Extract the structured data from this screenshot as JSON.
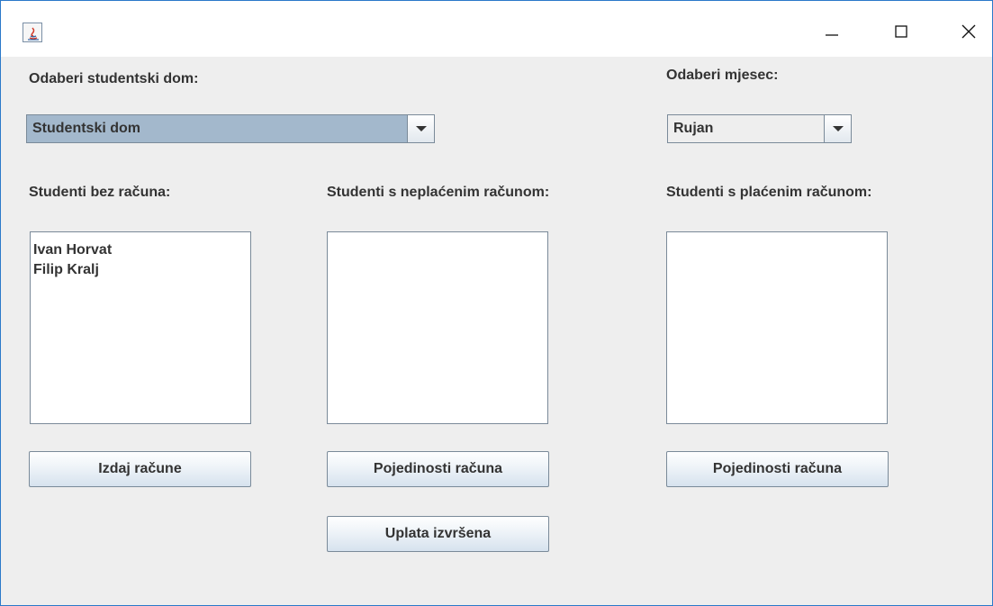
{
  "window": {
    "controls": {
      "minimize": "minimize-icon",
      "maximize": "maximize-icon",
      "close": "close-icon"
    }
  },
  "labels": {
    "dorm": "Odaberi studentski dom:",
    "month": "Odaberi mjesec:",
    "without_bill": "Studenti bez računa:",
    "unpaid": "Studenti s neplaćenim računom:",
    "paid": "Studenti s plaćenim računom:"
  },
  "dorm_select": {
    "value": "Studentski dom"
  },
  "month_select": {
    "value": "Rujan"
  },
  "lists": {
    "without_bill": [
      "Ivan Horvat",
      "Filip Kralj"
    ],
    "unpaid": [],
    "paid": []
  },
  "buttons": {
    "issue_bills": "Izdaj račune",
    "bill_details_unpaid": "Pojedinosti računa",
    "bill_details_paid": "Pojedinosti računa",
    "payment_done": "Uplata izvršena"
  },
  "colors": {
    "window_border": "#2b79c9",
    "panel_bg": "#eeeeee",
    "selected_combo": "#a3b8cc"
  }
}
